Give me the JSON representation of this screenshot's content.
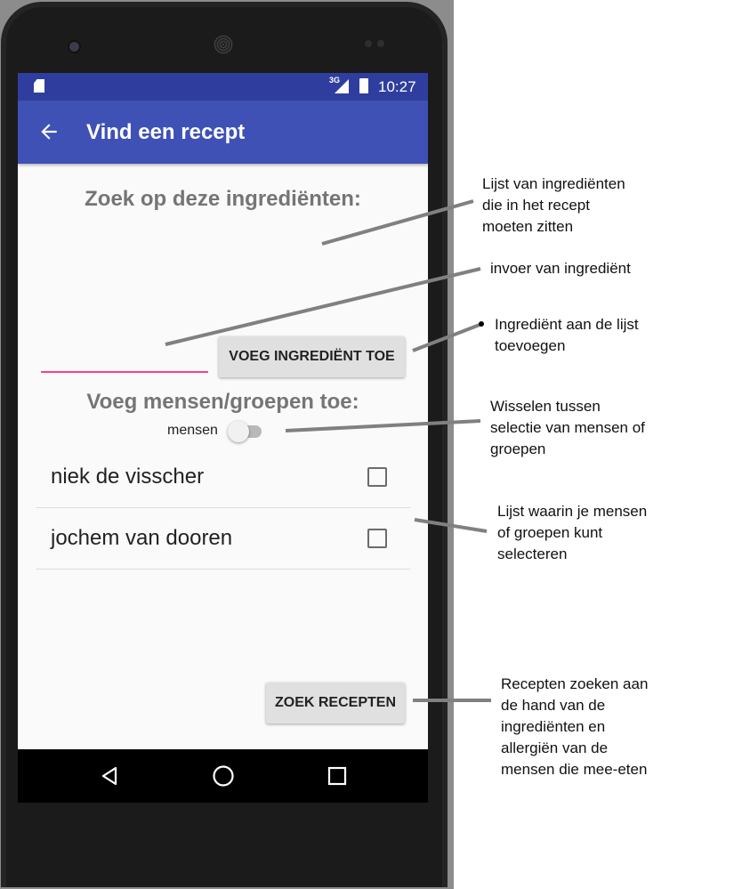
{
  "status_bar": {
    "signal_label": "3G",
    "time": "10:27"
  },
  "app_bar": {
    "title": "Vind een recept"
  },
  "ingredients": {
    "heading": "Zoek op deze ingrediënten:",
    "input_value": "",
    "add_button_label": "VOEG INGREDIËNT TOE"
  },
  "people": {
    "heading": "Voeg mensen/groepen toe:",
    "toggle_label": "mensen",
    "toggle_on": false,
    "items": [
      {
        "name": "niek de visscher",
        "checked": false
      },
      {
        "name": "jochem van dooren",
        "checked": false
      }
    ]
  },
  "search_button_label": "ZOEK RECEPTEN",
  "annotations": [
    {
      "lines": [
        "Lijst van ingrediënten",
        "die in het recept",
        "moeten zitten"
      ]
    },
    {
      "lines": [
        "invoer van ingrediënt"
      ]
    },
    {
      "lines": [
        "Ingrediënt aan de lijst",
        "toevoegen"
      ]
    },
    {
      "lines": [
        "Wisselen tussen",
        "selectie van mensen of",
        "groepen"
      ]
    },
    {
      "lines": [
        "Lijst waarin je mensen",
        "of groepen kunt",
        "selecteren"
      ]
    },
    {
      "lines": [
        "Recepten zoeken aan",
        "de hand van de",
        "ingrediënten en",
        "allergiën van de",
        "mensen die mee-eten"
      ]
    }
  ],
  "colors": {
    "primary": "#3f51b5",
    "primary_dark": "#2f3e9e",
    "accent": "#ff4081"
  }
}
